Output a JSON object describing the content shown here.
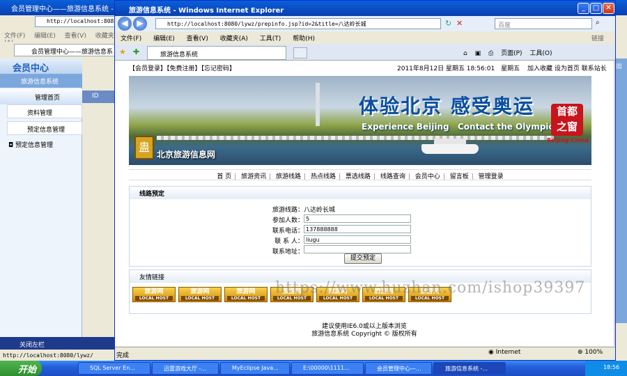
{
  "back_window": {
    "title": "会员管理中心——旅游信息系统 -",
    "address": "http://localhost:8080",
    "menu": [
      "文件(F)",
      "编辑(E)",
      "查看(V)",
      "收藏夹(A)"
    ],
    "tab": "会员管理中心——旅游信息系",
    "member_center": "会员中心",
    "site_name": "旅游信息系统",
    "nav_home": "管理首页",
    "items": [
      "资料管理",
      "预定信息管理",
      "预定信息管理"
    ],
    "id_label": "ID",
    "close_label": "关闭左栏",
    "status_url": "http://localhost:8080/lywz/",
    "right_exit": "出"
  },
  "front_window": {
    "title": "旅游信息系统 - Windows Internet Explorer",
    "address": "http://localhost:8080/lywz/prepinfo.jsp?id=2&title=八达岭长城",
    "search_placeholder": "百度",
    "menu": [
      "文件(F)",
      "编辑(E)",
      "查看(V)",
      "收藏夹(A)",
      "工具(T)",
      "帮助(H)"
    ],
    "links_label": "链接",
    "tab": "旅游信息系统",
    "cmd_page": "页面(P)",
    "cmd_tools": "工具(O)",
    "status_text": "完成",
    "status_zone": "Internet",
    "status_zoom": "100%"
  },
  "page": {
    "top_links": "【会员登录】【免费注册】【忘记密码】",
    "date": "2011年8月12日 星期五 18:56:01",
    "weekday": "星期五",
    "top_actions": "加入收藏 设为首页 联系站长",
    "banner": {
      "slogan": "体验北京 感受奥运",
      "en1": "Experience Beijing",
      "en2": "Contact the Olympics",
      "seal_top": "首都",
      "seal_bottom": "之窗",
      "seal_en": "Beijing-China",
      "logo_glyph": "蛊",
      "site_name": "北京旅游信息网"
    },
    "nav": [
      "首 页",
      "旅游资讯",
      "旅游线路",
      "热点线路",
      "票选线路",
      "线路查询",
      "会员中心",
      "留言板",
      "管理登录"
    ],
    "form": {
      "header": "线路预定",
      "route_label": "旅游线路：",
      "route_value": "八达岭长城",
      "people_label": "参加人数：",
      "people_value": "5",
      "phone_label": "联系电话：",
      "phone_value": "137888888",
      "contact_label": "联 系 人：",
      "contact_value": "liugu",
      "address_label": "联系地址：",
      "address_value": "",
      "submit": "提交预定"
    },
    "friend_links": {
      "header": "友情链接",
      "items": [
        "旅游网",
        "旅游网",
        "旅游网",
        "旅游网",
        "旅游网",
        "旅游网",
        "旅游网"
      ],
      "sub": "LOCAL HOST"
    },
    "watermark": "https://www.huzhan.com/ishop39397",
    "footer1": "建议使用IE6.0或以上版本浏览",
    "footer2": "旅游信息系统 Copyright © 版权所有"
  },
  "taskbar": {
    "start": "开始",
    "tasks": [
      "SQL Server En...",
      "迅雷游戏大厅 -...",
      "MyEclipse Java...",
      "E:\\00000\\1111...",
      "会员管理中心—...",
      "旅游信息系统 -..."
    ],
    "clock": "18:56"
  }
}
